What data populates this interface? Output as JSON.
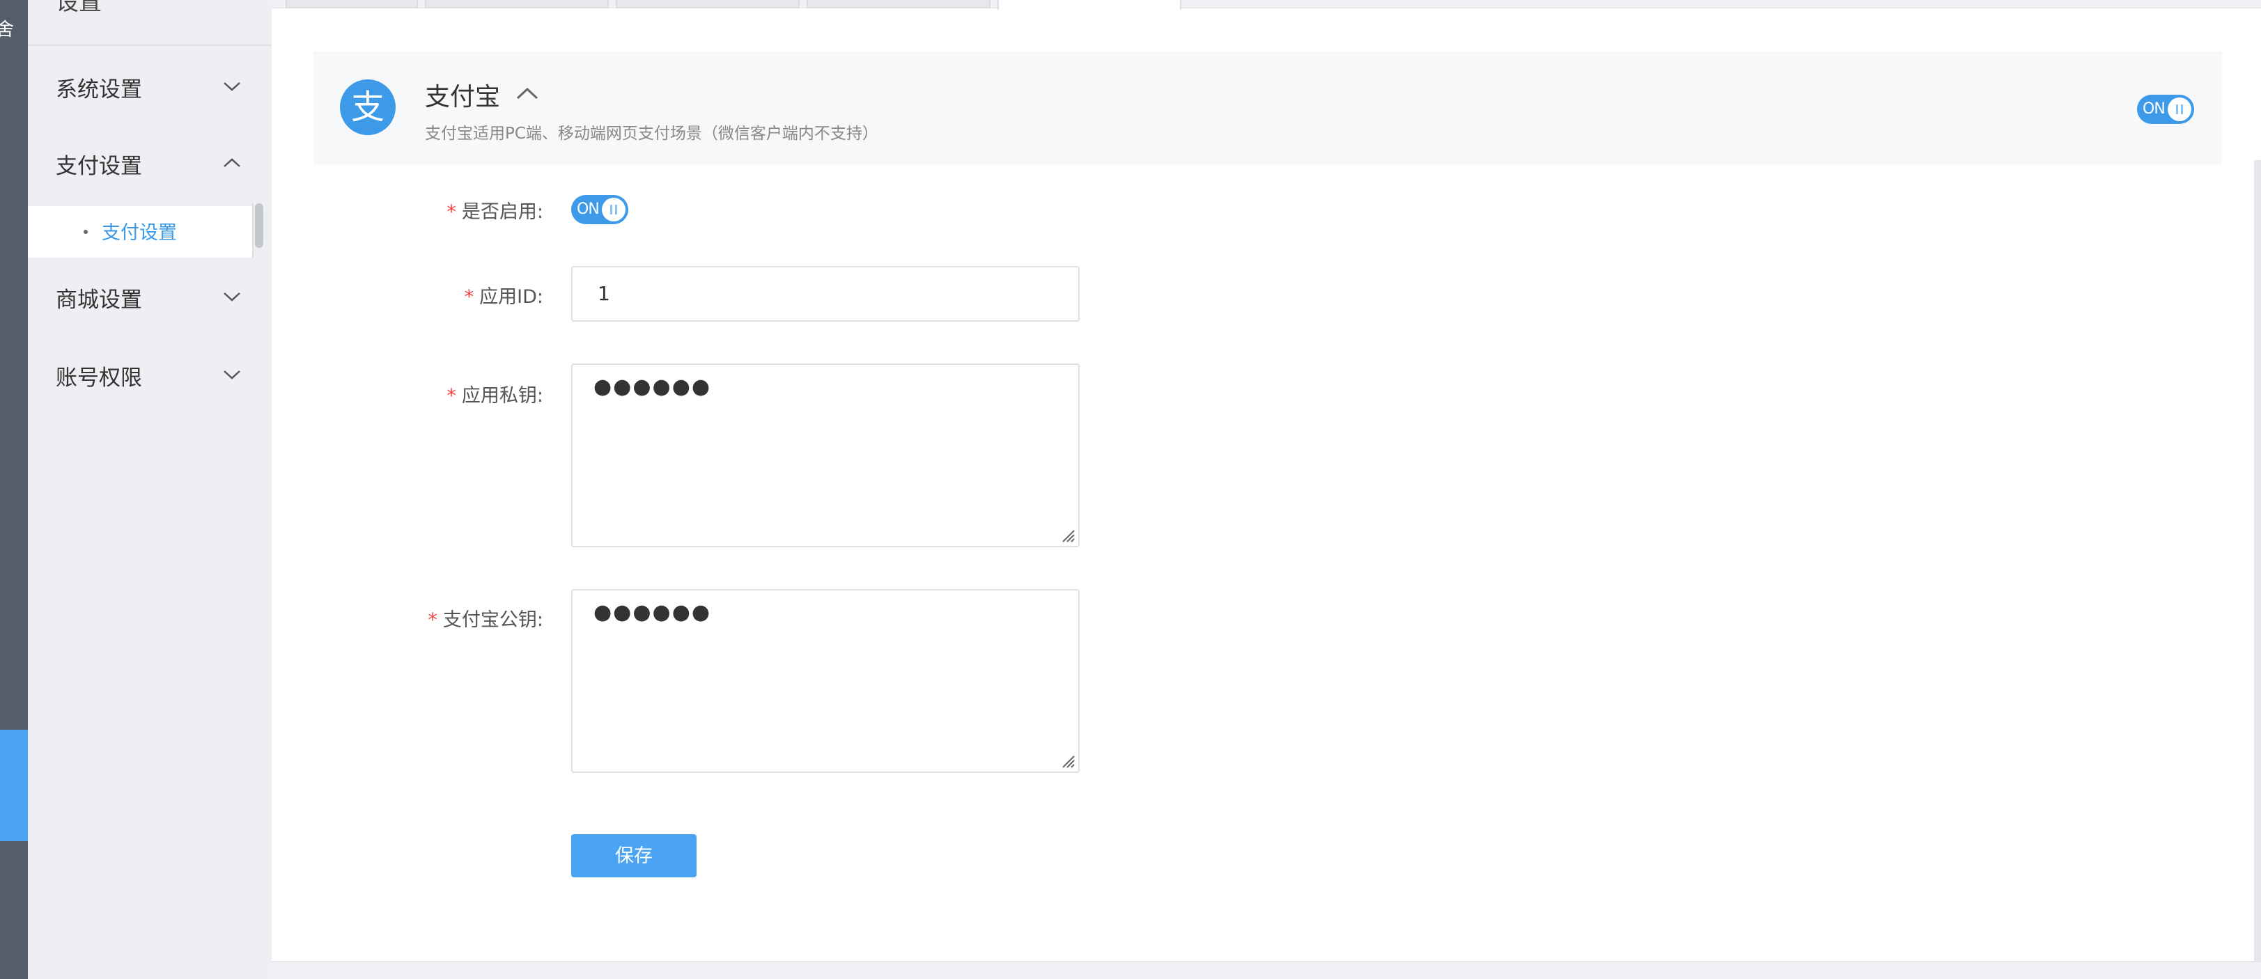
{
  "sidebar": {
    "strip_glyph": "舍",
    "title": "设置",
    "groups": [
      {
        "label": "系统设置",
        "expanded": false
      },
      {
        "label": "支付设置",
        "expanded": true,
        "children": [
          {
            "label": "支付设置",
            "active": true
          }
        ]
      },
      {
        "label": "商城设置",
        "expanded": false
      },
      {
        "label": "账号权限",
        "expanded": false
      }
    ]
  },
  "payment": {
    "logo_glyph": "支",
    "title": "支付宝",
    "description": "支付宝适用PC端、移动端网页支付场景（微信客户端内不支持）",
    "header_switch": "ON",
    "enabled": true
  },
  "form": {
    "enable_label": "是否启用:",
    "enable_switch": "ON",
    "app_id_label": "应用ID:",
    "app_id_value": "1",
    "private_key_label": "应用私钥:",
    "private_key_value": "●●●●●●",
    "public_key_label": "支付宝公钥:",
    "public_key_value": "●●●●●●",
    "required_mark": "*",
    "save_label": "保存"
  },
  "colors": {
    "accent": "#4aa3f3",
    "alipay_blue": "#3d9ae8",
    "required": "#ee4444",
    "sidebar_bg": "#edeff3",
    "nav_strip": "#545e6a"
  }
}
